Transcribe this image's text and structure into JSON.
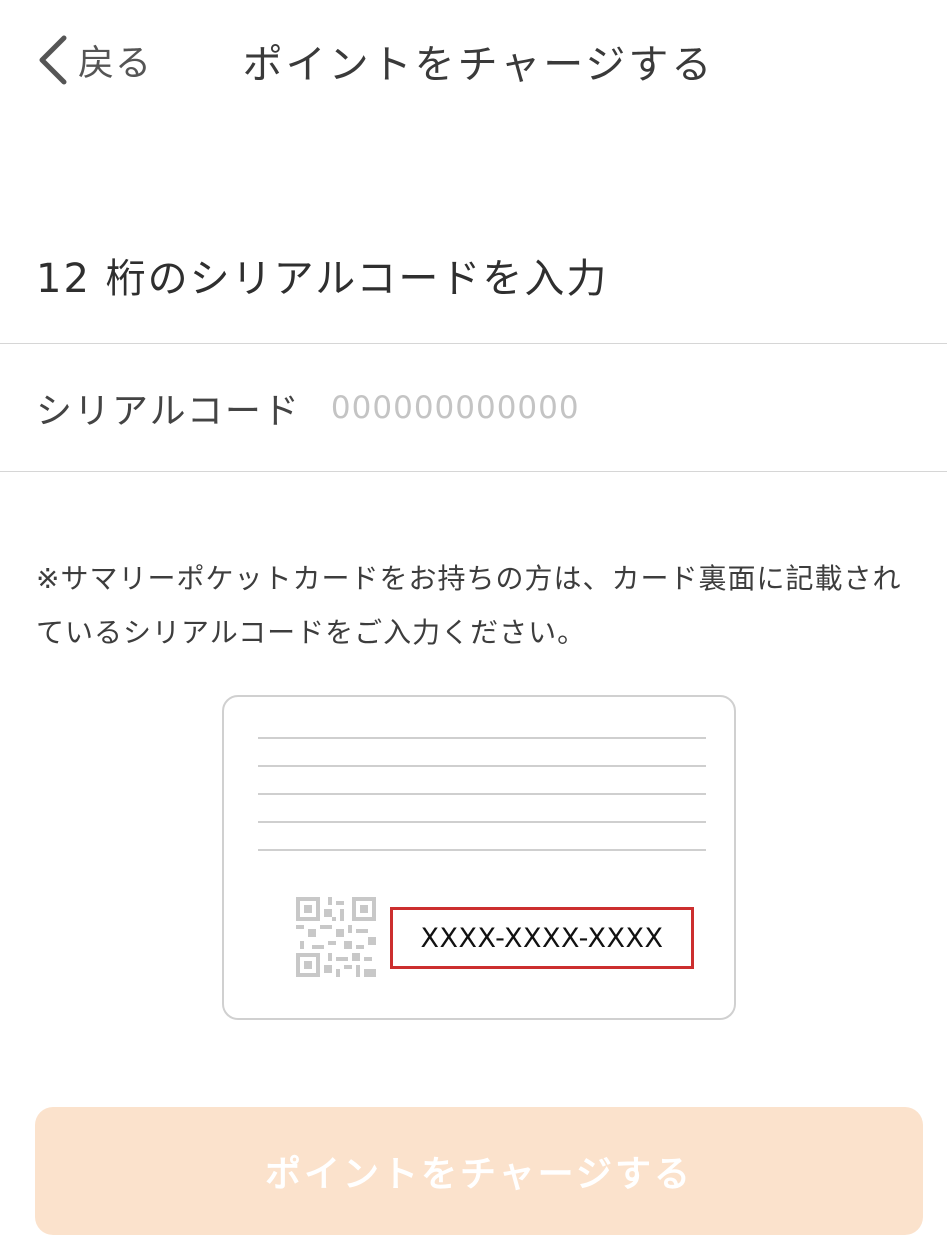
{
  "header": {
    "back_label": "戻る",
    "title": "ポイントをチャージする"
  },
  "section": {
    "heading": "12 桁のシリアルコードを入力"
  },
  "serial_field": {
    "label": "シリアルコード",
    "placeholder": "000000000000",
    "value": ""
  },
  "note": {
    "text": "※サマリーポケットカードをお持ちの方は、カード裏面に記載されているシリアルコードをご入力ください。"
  },
  "card_illustration": {
    "serial_example": "XXXX-XXXX-XXXX",
    "highlight_color": "#cc2f2f"
  },
  "charge_button": {
    "label": "ポイントをチャージする",
    "state": "disabled",
    "color": "#fbe2cc"
  },
  "icons": {
    "back": "chevron-left-icon",
    "qr": "qr-code-icon"
  }
}
